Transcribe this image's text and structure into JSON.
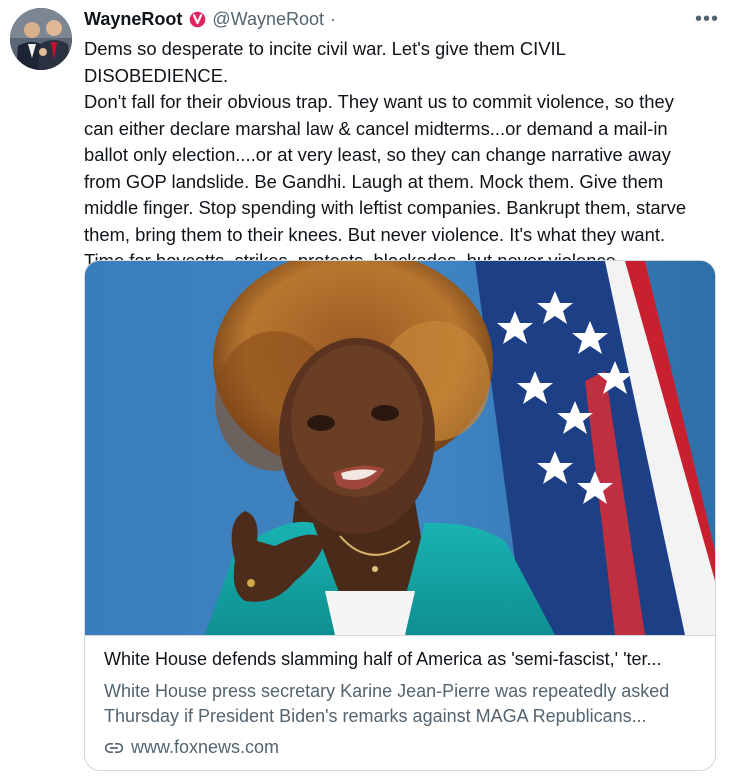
{
  "tweet": {
    "display_name": "WayneRoot",
    "handle": "@WayneRoot",
    "separator": "·",
    "more_label": "•••",
    "text": "Dems so desperate to incite civil war. Let's give them CIVIL DISOBEDIENCE.\nDon't fall for their obvious trap. They want us to commit violence, so they\ncan either declare marshal law & cancel midterms...or demand a mail-in\nballot only election....or at very least, so they can change narrative away\nfrom GOP landslide. Be Gandhi. Laugh at them. Mock them. Give them\nmiddle finger. Stop spending with leftist companies. Bankrupt them, starve\nthem, bring them to their knees. But never violence. It's what they want.\nTime for boycotts, strikes, protests, blockades, but never violence."
  },
  "card": {
    "title": "White House defends slamming half of America as 'semi-fascist,' 'ter...",
    "desc_line1": "White House press secretary Karine Jean-Pierre was repeatedly asked",
    "desc_line2": "Thursday if President Biden's remarks against MAGA Republicans...",
    "domain": "www.foxnews.com"
  },
  "icons": {
    "verified": "verified-badge-icon",
    "more": "more-options-icon",
    "link": "link-icon"
  },
  "colors": {
    "verified_badge": "#e0245e",
    "text_primary": "#0f1419",
    "text_secondary": "#536471",
    "border": "#cfd9de",
    "jacket_teal": "#14a6a6",
    "backdrop_blue": "#3d7fb9"
  }
}
